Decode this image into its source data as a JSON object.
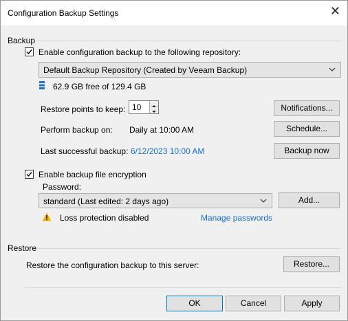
{
  "window": {
    "title": "Configuration Backup Settings"
  },
  "backup": {
    "group_label": "Backup",
    "enable_label": "Enable configuration backup to the following repository:",
    "repository": "Default Backup Repository (Created by Veeam Backup)",
    "storage_info": "62.9 GB free of 129.4 GB",
    "restore_points_label": "Restore points to keep:",
    "restore_points_value": "10",
    "notifications_button": "Notifications...",
    "perform_label": "Perform backup on:",
    "perform_value": "Daily at 10:00 AM",
    "schedule_button": "Schedule...",
    "last_label": "Last successful backup:",
    "last_value": "6/12/2023 10:00 AM",
    "backup_now_button": "Backup now"
  },
  "encryption": {
    "enable_label": "Enable backup file encryption",
    "password_label": "Password:",
    "password_value": "standard (Last edited: 2 days ago)",
    "add_button": "Add...",
    "warning_text": "Loss protection disabled",
    "manage_link": "Manage passwords"
  },
  "restore": {
    "group_label": "Restore",
    "description": "Restore the configuration backup to this server:",
    "restore_button": "Restore..."
  },
  "footer": {
    "ok": "OK",
    "cancel": "Cancel",
    "apply": "Apply"
  },
  "colors": {
    "link": "#1a6fd4",
    "warning": "#f0b400",
    "focus_border": "#0078d7"
  }
}
